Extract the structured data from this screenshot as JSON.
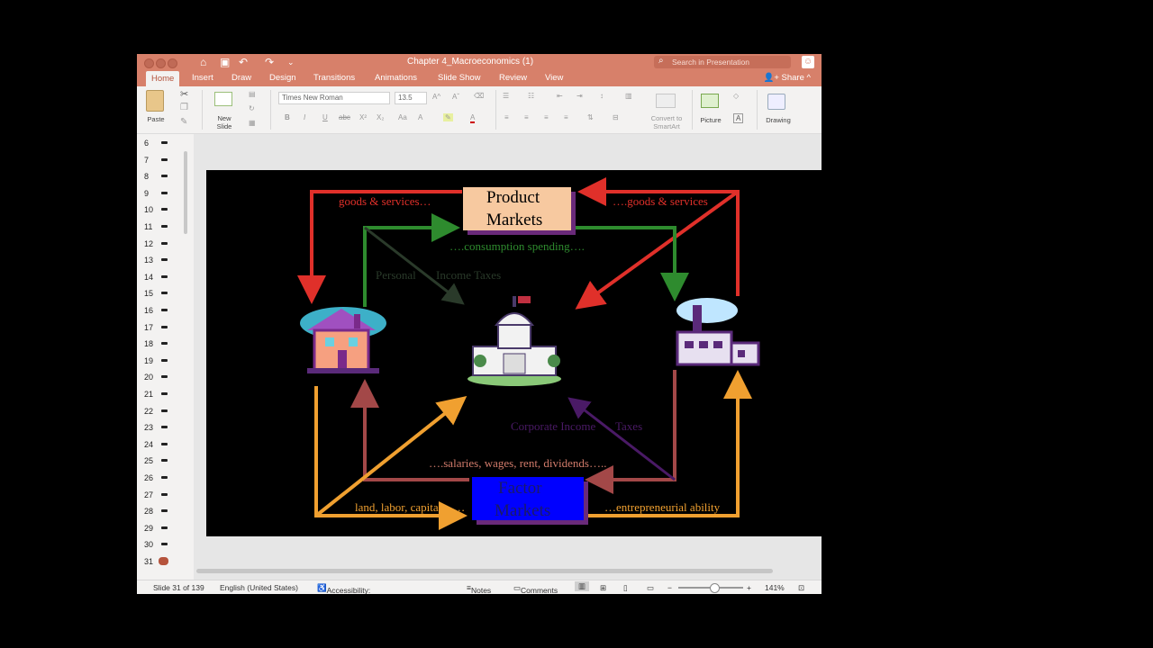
{
  "window": {
    "title": "Chapter 4_Macroeconomics (1)"
  },
  "titlebar": {
    "search_placeholder": "Search in Presentation"
  },
  "tabs": [
    {
      "label": "Home"
    },
    {
      "label": "Insert"
    },
    {
      "label": "Draw"
    },
    {
      "label": "Design"
    },
    {
      "label": "Transitions"
    },
    {
      "label": "Animations"
    },
    {
      "label": "Slide Show"
    },
    {
      "label": "Review"
    },
    {
      "label": "View"
    }
  ],
  "share_label": "Share",
  "ribbon": {
    "paste": "Paste",
    "new_slide_1": "New",
    "new_slide_2": "Slide",
    "font_name": "Times New Roman",
    "font_size": "13.5",
    "convert_1": "Convert to",
    "convert_2": "SmartArt",
    "picture": "Picture",
    "drawing": "Drawing"
  },
  "thumbnails": [
    "6",
    "7",
    "8",
    "9",
    "10",
    "11",
    "12",
    "13",
    "14",
    "15",
    "16",
    "17",
    "18",
    "19",
    "20",
    "21",
    "22",
    "23",
    "24",
    "25",
    "26",
    "27",
    "28",
    "29",
    "30",
    "31"
  ],
  "slide": {
    "product_markets_1": "Product",
    "product_markets_2": "Markets",
    "factor_markets_1": "Factor",
    "factor_markets_2": "Markets",
    "goods_left": "goods & services…",
    "goods_right": "….goods & services",
    "consumption": "….consumption spending….",
    "personal": "Personal",
    "income_taxes": "Income Taxes",
    "corporate": "Corporate Income",
    "taxes": "Taxes",
    "salaries": "….salaries, wages, rent, dividends…..",
    "land": "land, labor, capital……",
    "entrepreneurial": "…entrepreneurial ability"
  },
  "status": {
    "slide_of": "Slide 31 of 139",
    "language": "English (United States)",
    "accessibility": "Accessibility: Investigate",
    "notes": "Notes",
    "comments": "Comments",
    "zoom": "141%"
  },
  "colors": {
    "brand": "#d7806a",
    "red_flow": "#e0302a",
    "green_flow": "#2e8b2e",
    "orange_flow": "#f0a030",
    "product_box": "#f7c9a0",
    "factor_box": "#0000ff"
  }
}
